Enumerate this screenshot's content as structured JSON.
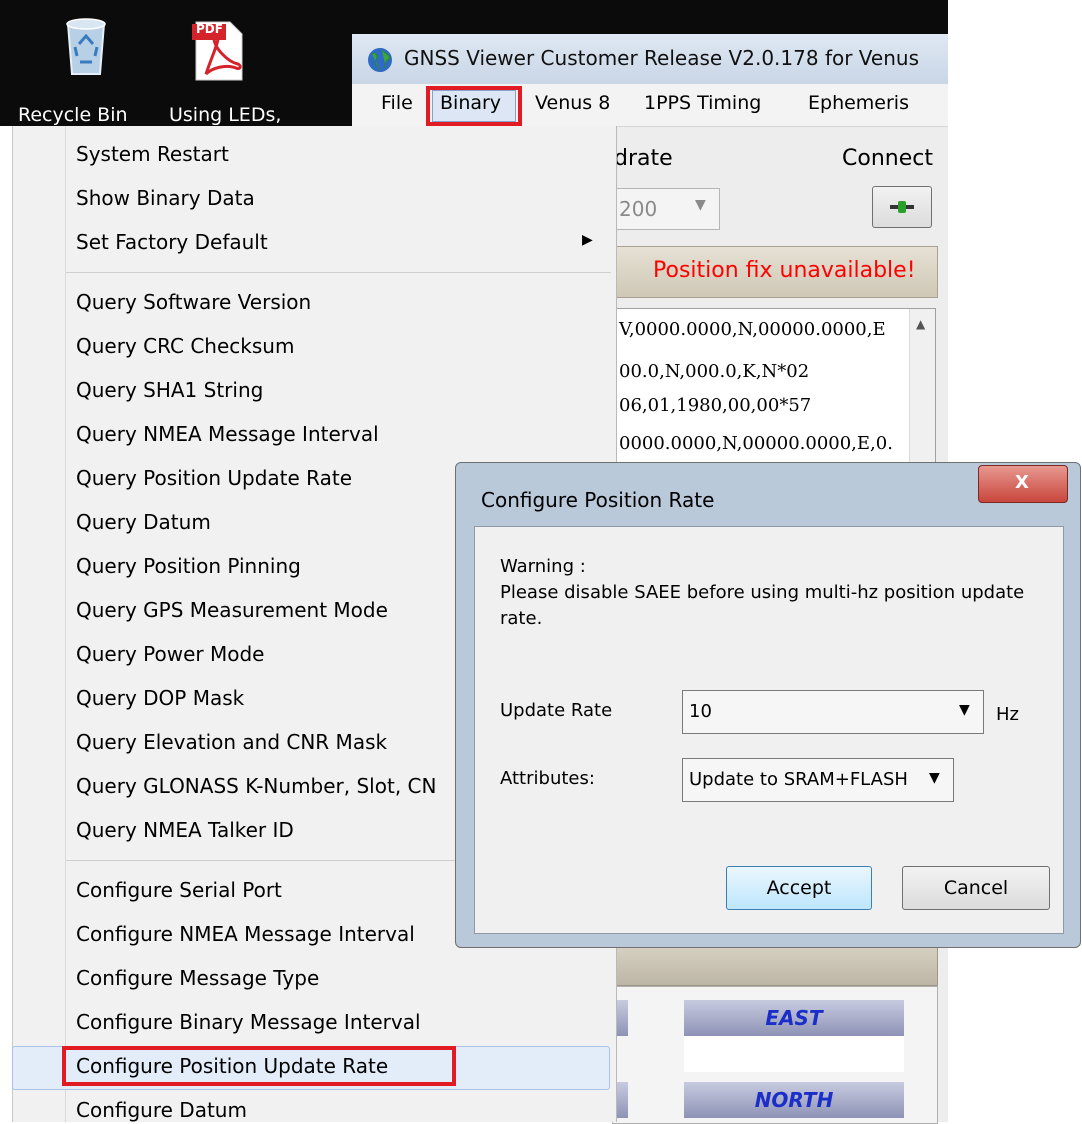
{
  "desktop": {
    "icons": [
      {
        "label": "Recycle Bin",
        "icon": "recycle-bin-icon"
      },
      {
        "label": "Using LEDs,",
        "icon": "pdf-file-icon",
        "badge": "PDF"
      }
    ]
  },
  "window": {
    "title": "GNSS Viewer Customer Release V2.0.178 for Venus",
    "menu": [
      "File",
      "Binary",
      "Venus 8",
      "1PPS Timing",
      "Ephemeris"
    ],
    "baudrate_label": "drate",
    "baudrate_value": "200",
    "connect_label": "Connect",
    "status_text": "Position fix unavailable!",
    "nmea_lines": [
      "V,0000.0000,N,00000.0000,E",
      "00.0,N,000.0,K,N*02",
      "06,01,1980,00,00*57",
      "0000.0000,N,00000.0000,E,0."
    ],
    "east_label": "EAST",
    "north_label": "NORTH"
  },
  "binary_menu": {
    "items": [
      "System Restart",
      "Show Binary Data",
      "Set Factory Default",
      "Query Software Version",
      "Query CRC Checksum",
      "Query SHA1 String",
      "Query NMEA Message Interval",
      "Query Position Update Rate",
      "Query Datum",
      "Query Position Pinning",
      "Query GPS Measurement Mode",
      "Query Power Mode",
      "Query DOP Mask",
      "Query Elevation and CNR Mask",
      "Query GLONASS K-Number, Slot, CN",
      "Query NMEA Talker ID",
      "Configure Serial Port",
      "Configure NMEA Message Interval",
      "Configure Message Type",
      "Configure Binary Message Interval",
      "Configure Position Update Rate",
      "Configure Datum"
    ]
  },
  "dialog": {
    "title": "Configure Position Rate",
    "warning_title": "Warning :",
    "warning_line1": "Please disable SAEE before using multi-hz position update",
    "warning_line2": "rate.",
    "update_rate_label": "Update Rate",
    "update_rate_value": "10",
    "update_rate_unit": "Hz",
    "attributes_label": "Attributes:",
    "attributes_value": "Update to SRAM+FLASH",
    "accept_label": "Accept",
    "cancel_label": "Cancel",
    "close_glyph": "X"
  },
  "colors": {
    "highlight_box": "#e01b24",
    "status_red": "#ff0000",
    "close_button": "#c9463d"
  }
}
